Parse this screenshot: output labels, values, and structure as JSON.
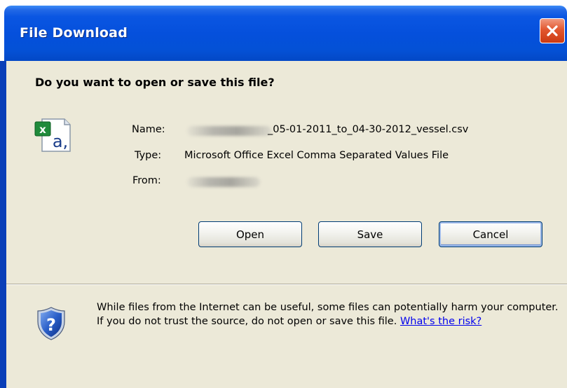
{
  "window": {
    "title": "File Download",
    "close_icon": "close-icon"
  },
  "dialog": {
    "question": "Do you want to open or save this file?",
    "file_icon": "csv-file-icon",
    "name_label": "Name:",
    "name_value": "_05-01-2011_to_04-30-2012_vessel.csv",
    "type_label": "Type:",
    "type_value": "Microsoft Office Excel Comma Separated Values File",
    "from_label": "From:"
  },
  "buttons": {
    "open_label": "Open",
    "save_label": "Save",
    "cancel_label": "Cancel"
  },
  "warning": {
    "icon": "shield-question-icon",
    "text": "While files from the Internet can be useful, some files can potentially harm your computer. If you do not trust the source, do not open or save this file.",
    "link_text": "What's the risk?"
  },
  "colors": {
    "title_bar": "#0550dc",
    "dialog_bg": "#ece9d8",
    "close_button": "#e2572f",
    "link": "#0000ee"
  }
}
